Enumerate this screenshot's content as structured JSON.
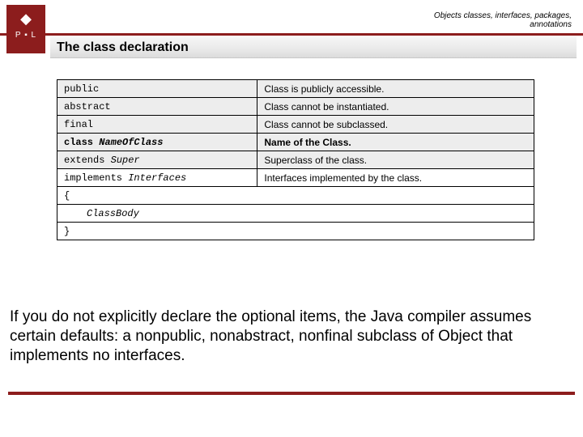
{
  "header": {
    "breadcrumb_line1": "Objects classes, interfaces, packages,",
    "breadcrumb_line2": "annotations"
  },
  "logo": {
    "eagle_glyph": "◆",
    "label": "P ▪ L"
  },
  "title": "The class declaration",
  "table": {
    "rows": [
      {
        "left_prefix": "public",
        "left_italic": "",
        "right": "Class is publicly accessible.",
        "bold": false
      },
      {
        "left_prefix": "abstract",
        "left_italic": "",
        "right": "Class cannot be instantiated.",
        "bold": false
      },
      {
        "left_prefix": "final",
        "left_italic": "",
        "right": "Class cannot be subclassed.",
        "bold": false
      },
      {
        "left_prefix": "class ",
        "left_italic": "NameOfClass",
        "right": "Name of the Class.",
        "bold": true
      },
      {
        "left_prefix": "extends ",
        "left_italic": "Super",
        "right": "Superclass of the class.",
        "bold": false
      },
      {
        "left_prefix": "implements ",
        "left_italic": "Interfaces",
        "right": "Interfaces implemented by the class.",
        "bold": false
      },
      {
        "left_prefix": "{",
        "left_italic": "",
        "right": "",
        "bold": false
      },
      {
        "left_prefix": "",
        "left_italic": "ClassBody",
        "right": "",
        "bold": false,
        "indent": true
      },
      {
        "left_prefix": "}",
        "left_italic": "",
        "right": "",
        "bold": false
      }
    ]
  },
  "paragraph": "If you do not explicitly declare the optional items, the Java compiler assumes certain defaults: a nonpublic, nonabstract, nonfinal subclass of Object that implements no interfaces."
}
